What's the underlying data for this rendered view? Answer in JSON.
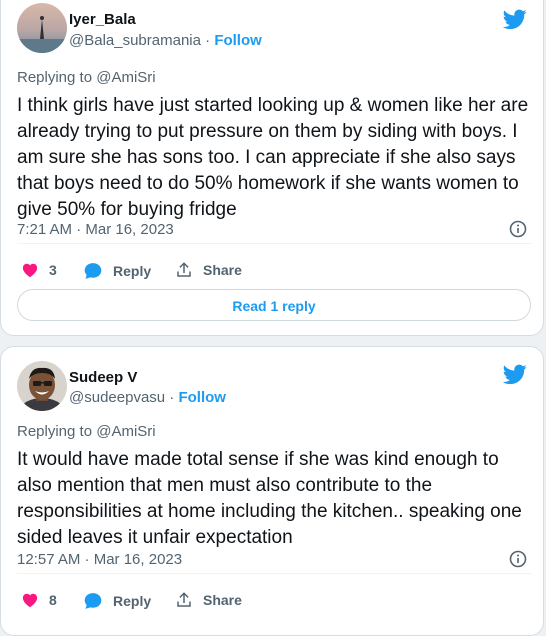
{
  "tweets": [
    {
      "name": "Iyer_Bala",
      "handle": "@Bala_subramania",
      "separator": "·",
      "follow": "Follow",
      "replying_to": "Replying to @AmiSri",
      "text": "I think girls have just started looking up & women like her are already trying to put pressure on them by siding with boys. I am sure she has sons too. I can appreciate if she also says that boys need to do 50% homework if she wants women to give 50% for buying fridge",
      "timestamp": "7:21 AM · Mar 16, 2023",
      "likes": "3",
      "reply_label": "Reply",
      "share_label": "Share",
      "read_replies": "Read 1 reply"
    },
    {
      "name": "Sudeep V",
      "handle": "@sudeepvasu",
      "separator": "·",
      "follow": "Follow",
      "replying_to": "Replying to @AmiSri",
      "text": "It would have made total sense if she was kind enough to also mention that men must also contribute to the responsibilities at home including the kitchen.. speaking one sided leaves it unfair expectation",
      "timestamp": "12:57 AM · Mar 16, 2023",
      "likes": "8",
      "reply_label": "Reply",
      "share_label": "Share"
    }
  ],
  "icons": {
    "bird": "twitter-bird-icon",
    "info": "info-icon",
    "like": "heart-icon",
    "reply": "speech-bubble-icon",
    "share": "share-upload-icon"
  },
  "colors": {
    "brand": "#1d9bf0",
    "like": "#f91880",
    "secondary_text": "#536471",
    "background": "#eef1f3"
  }
}
